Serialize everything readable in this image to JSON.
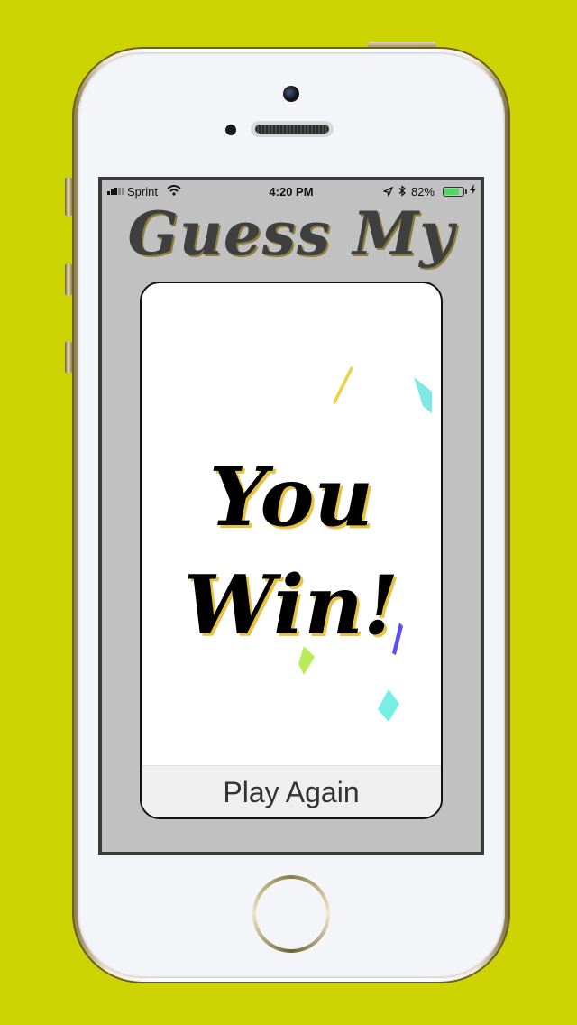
{
  "status_bar": {
    "carrier": "Sprint",
    "time": "4:20 PM",
    "battery_percent": "82%",
    "battery_level": 0.82,
    "icons": [
      "signal-icon",
      "wifi-icon",
      "location-icon",
      "bluetooth-icon",
      "battery-icon",
      "charging-icon"
    ]
  },
  "app": {
    "title": "Guess My"
  },
  "result": {
    "line1": "You",
    "line2": "Win!"
  },
  "actions": {
    "play_again_label": "Play Again"
  },
  "colors": {
    "background": "#cdd300",
    "screen_background": "#c1c1c1",
    "card_background": "#ffffff",
    "title_text": "#3f3f3f",
    "win_text": "#000000",
    "win_shadow": "#e8c245",
    "confetti": [
      "#f0d14a",
      "#7ee8e2",
      "#5b4ff0",
      "#b8ec5a",
      "#76f0e4"
    ]
  }
}
